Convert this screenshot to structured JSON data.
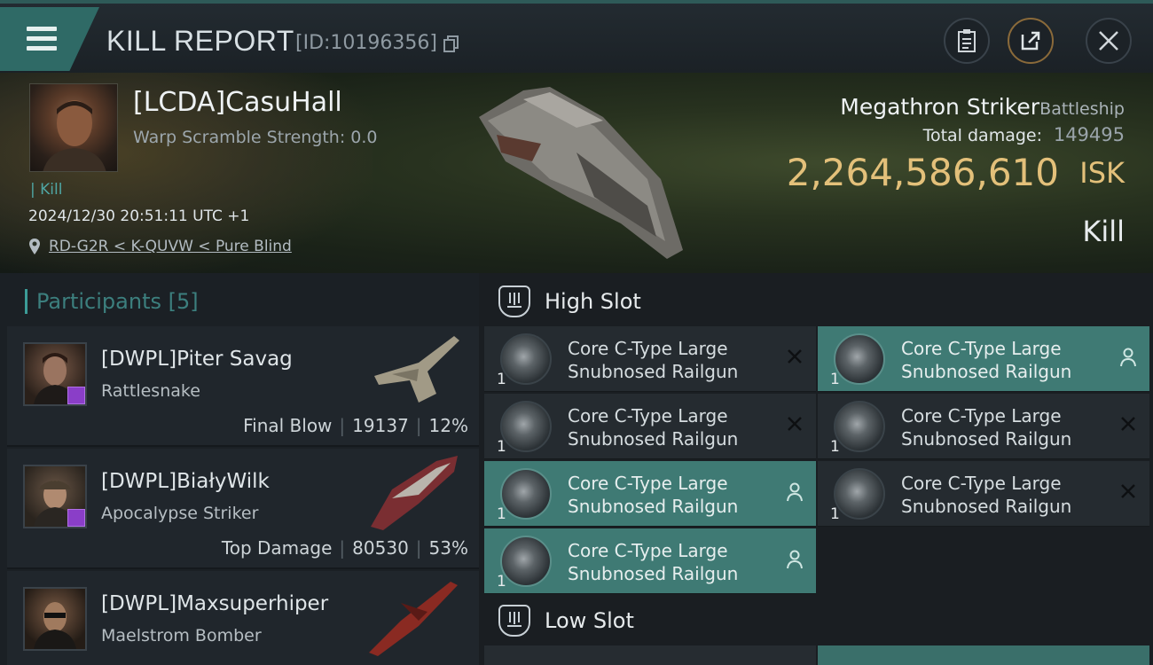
{
  "header": {
    "title": "KILL REPORT",
    "report_id": "[ID:10196356]"
  },
  "victim": {
    "name": "[LCDA]CasuHall",
    "warp_scramble": "Warp Scramble Strength: 0.0",
    "tag": "Kill",
    "time": "2024/12/30 20:51:11 UTC +1",
    "location": "RD-G2R < K-QUVW < Pure Blind",
    "ship_name": "Megathron Striker",
    "ship_class": "Battleship",
    "damage_label": "Total damage:",
    "damage_value": "149495",
    "isk_value": "2,264,586,610",
    "isk_unit": "ISK",
    "result": "Kill"
  },
  "participants": {
    "label": "Participants [5]",
    "rows": [
      {
        "name": "[DWPL]Piter Savag",
        "ship": "Rattlesnake",
        "role": "Final Blow",
        "damage": "19137",
        "percent": "12%"
      },
      {
        "name": "[DWPL]BiałyWilk",
        "ship": "Apocalypse Striker",
        "role": "Top Damage",
        "damage": "80530",
        "percent": "53%"
      },
      {
        "name": "[DWPL]Maxsuperhiper",
        "ship": "Maelstrom Bomber",
        "role": "",
        "damage": "",
        "percent": ""
      }
    ]
  },
  "slots": {
    "high_label": "High Slot",
    "low_label": "Low Slot",
    "modules": [
      {
        "line1": "Core C-Type Large",
        "line2": "Snubnosed Railgun",
        "qty": "1",
        "state": "destroyed"
      },
      {
        "line1": "Core C-Type Large",
        "line2": "Snubnosed Railgun",
        "qty": "1",
        "state": "dropped"
      },
      {
        "line1": "Core C-Type Large",
        "line2": "Snubnosed Railgun",
        "qty": "1",
        "state": "destroyed"
      },
      {
        "line1": "Core C-Type Large",
        "line2": "Snubnosed Railgun",
        "qty": "1",
        "state": "destroyed"
      },
      {
        "line1": "Core C-Type Large",
        "line2": "Snubnosed Railgun",
        "qty": "1",
        "state": "dropped"
      },
      {
        "line1": "Core C-Type Large",
        "line2": "Snubnosed Railgun",
        "qty": "1",
        "state": "destroyed"
      },
      {
        "line1": "Core C-Type Large",
        "line2": "Snubnosed Railgun",
        "qty": "1",
        "state": "dropped"
      }
    ]
  },
  "colors": {
    "accent": "#3f7a74",
    "isk": "#e3c07a",
    "badge": "#8a3ec8"
  }
}
